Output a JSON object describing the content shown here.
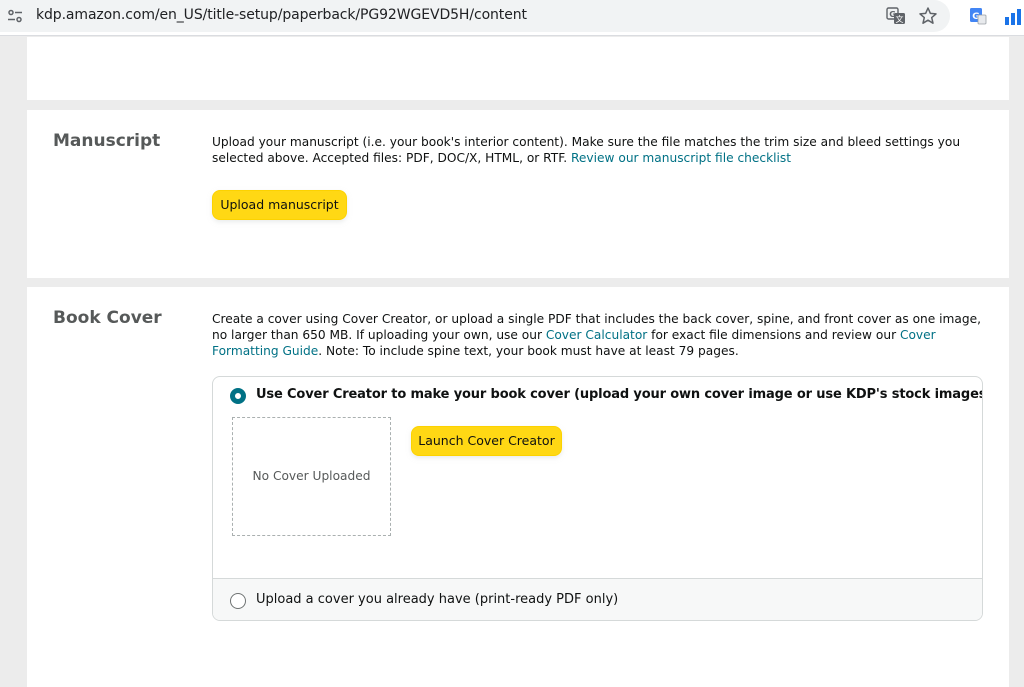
{
  "browser": {
    "url": "kdp.amazon.com/en_US/title-setup/paperback/PG92WGEVD5H/content",
    "icons": [
      "site-info-icon",
      "translate-icon",
      "star-icon",
      "google-translate-extension-icon",
      "apps-icon"
    ]
  },
  "manuscript": {
    "title": "Manuscript",
    "description": "Upload your manuscript (i.e. your book's interior content). Make sure the file matches the trim size and bleed settings you selected above. Accepted files: PDF, DOC/X, HTML, or RTF.",
    "checklist_link": "Review our manuscript file checklist",
    "upload_button": "Upload manuscript"
  },
  "book_cover": {
    "title": "Book Cover",
    "desc_part1": "Create a cover using Cover Creator, or upload a single PDF that includes the back cover, spine, and front cover as one image, no larger than 650 MB. If uploading your own, use our",
    "calculator_link": "Cover Calculator",
    "desc_part2": "for exact file dimensions and review our",
    "formatting_link": "Cover Formatting Guide",
    "desc_part3": ". Note: To include spine text, your book must have at least 79 pages.",
    "option_creator_label": "Use Cover Creator to make your book cover (upload your own cover image or use KDP's stock images)",
    "launch_button": "Launch Cover Creator",
    "no_cover_text": "No Cover Uploaded",
    "option_upload_label": "Upload a cover you already have (print-ready PDF only)",
    "selected_option": "cover-creator"
  },
  "colors": {
    "button_yellow": "#ffd814",
    "link_teal": "#007185",
    "section_title_gray": "#565959",
    "page_background": "#ececec"
  }
}
